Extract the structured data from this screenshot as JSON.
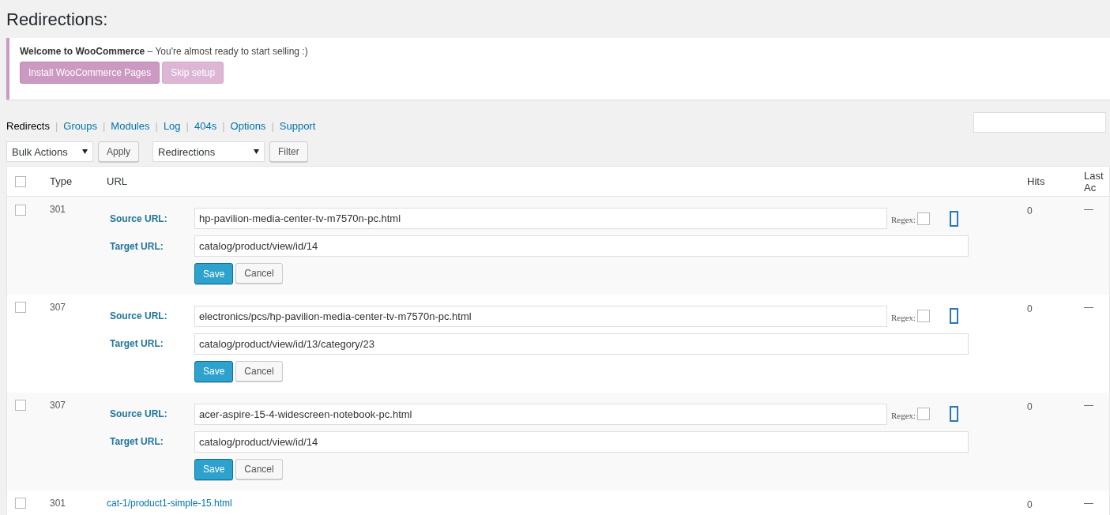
{
  "page_title": "Redirections:",
  "notice": {
    "title": "Welcome to WooCommerce",
    "dash": "–",
    "message": "You're almost ready to start selling :)",
    "buttons": [
      {
        "label": "Install WooCommerce Pages",
        "kind": "primary"
      },
      {
        "label": "Skip setup",
        "kind": "secondary"
      }
    ]
  },
  "subnav_separator": "|",
  "subnav": [
    {
      "label": "Redirects",
      "selected": true
    },
    {
      "label": "Groups",
      "selected": false
    },
    {
      "label": "Modules",
      "selected": false
    },
    {
      "label": "Log",
      "selected": false
    },
    {
      "label": "404s",
      "selected": false
    },
    {
      "label": "Options",
      "selected": false
    },
    {
      "label": "Support",
      "selected": false
    }
  ],
  "toolbar": {
    "bulk_actions": "Bulk Actions",
    "apply": "Apply",
    "group_filter": "Redirections",
    "filter": "Filter"
  },
  "table": {
    "select_all_checked": false,
    "columns": [
      "Type",
      "URL",
      "Hits",
      "Last Ac"
    ],
    "rows": [
      {
        "kind": "edit",
        "checked": false,
        "type": "301",
        "source_label": "Source URL:",
        "source": "hp-pavilion-media-center-tv-m7570n-pc.html",
        "regex_label": "Regex:",
        "regex": false,
        "target_label": "Target URL:",
        "target": "catalog/product/view/id/14",
        "save": "Save",
        "cancel": "Cancel",
        "hits": "0",
        "last_access": "—"
      },
      {
        "kind": "edit",
        "checked": false,
        "type": "307",
        "source_label": "Source URL:",
        "source": "electronics/pcs/hp-pavilion-media-center-tv-m7570n-pc.html",
        "regex_label": "Regex:",
        "regex": false,
        "target_label": "Target URL:",
        "target": "catalog/product/view/id/13/category/23",
        "save": "Save",
        "cancel": "Cancel",
        "hits": "0",
        "last_access": "—"
      },
      {
        "kind": "edit",
        "checked": false,
        "type": "307",
        "source_label": "Source URL:",
        "source": "acer-aspire-15-4-widescreen-notebook-pc.html",
        "regex_label": "Regex:",
        "regex": false,
        "target_label": "Target URL:",
        "target": "catalog/product/view/id/14",
        "save": "Save",
        "cancel": "Cancel",
        "hits": "0",
        "last_access": "—"
      },
      {
        "kind": "plain",
        "checked": false,
        "type": "301",
        "url": "cat-1/product1-simple-15.html",
        "hits": "0",
        "last_access": "—"
      }
    ]
  }
}
